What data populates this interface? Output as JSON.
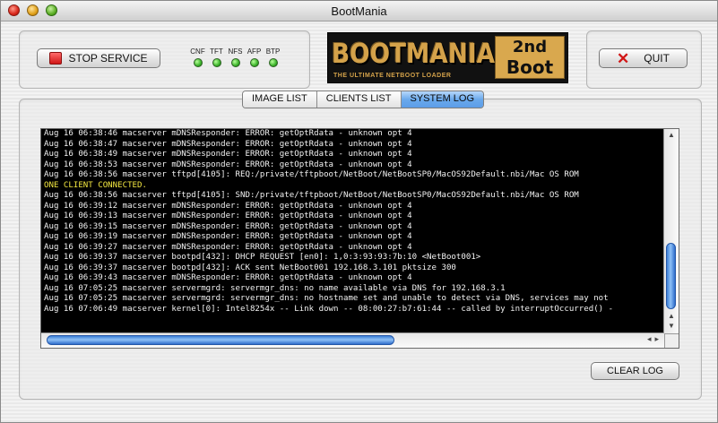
{
  "window": {
    "title": "BootMania"
  },
  "controls": {
    "stop_label": "STOP SERVICE",
    "quit_label": "QUIT"
  },
  "status_leds": [
    {
      "label": "CNF",
      "state": "on"
    },
    {
      "label": "TFT",
      "state": "on"
    },
    {
      "label": "NFS",
      "state": "on"
    },
    {
      "label": "AFP",
      "state": "on"
    },
    {
      "label": "BTP",
      "state": "on"
    }
  ],
  "logo": {
    "main": "BOOTMANIA",
    "subtitle": "THE ULTIMATE NETBOOT LOADER",
    "badge_line1": "2nd",
    "badge_line2": "Boot"
  },
  "tabs": [
    {
      "label": "IMAGE LIST",
      "active": false
    },
    {
      "label": "CLIENTS LIST",
      "active": false
    },
    {
      "label": "SYSTEM LOG",
      "active": true
    }
  ],
  "log": {
    "lines": [
      {
        "text": "Aug 16 06:38:46 macserver mDNSResponder: ERROR: getOptRdata - unknown opt 4",
        "color": "white"
      },
      {
        "text": "Aug 16 06:38:47 macserver mDNSResponder: ERROR: getOptRdata - unknown opt 4",
        "color": "white"
      },
      {
        "text": "Aug 16 06:38:49 macserver mDNSResponder: ERROR: getOptRdata - unknown opt 4",
        "color": "white"
      },
      {
        "text": "Aug 16 06:38:53 macserver mDNSResponder: ERROR: getOptRdata - unknown opt 4",
        "color": "white"
      },
      {
        "text": "Aug 16 06:38:56 macserver tftpd[4105]: REQ:/private/tftpboot/NetBoot/NetBootSP0/MacOS92Default.nbi/Mac OS ROM",
        "color": "white"
      },
      {
        "text": "ONE CLIENT CONNECTED.",
        "color": "yellow"
      },
      {
        "text": "Aug 16 06:38:56 macserver tftpd[4105]: SND:/private/tftpboot/NetBoot/NetBootSP0/MacOS92Default.nbi/Mac OS ROM",
        "color": "white"
      },
      {
        "text": "Aug 16 06:39:12 macserver mDNSResponder: ERROR: getOptRdata - unknown opt 4",
        "color": "white"
      },
      {
        "text": "Aug 16 06:39:13 macserver mDNSResponder: ERROR: getOptRdata - unknown opt 4",
        "color": "white"
      },
      {
        "text": "Aug 16 06:39:15 macserver mDNSResponder: ERROR: getOptRdata - unknown opt 4",
        "color": "white"
      },
      {
        "text": "Aug 16 06:39:19 macserver mDNSResponder: ERROR: getOptRdata - unknown opt 4",
        "color": "white"
      },
      {
        "text": "Aug 16 06:39:27 macserver mDNSResponder: ERROR: getOptRdata - unknown opt 4",
        "color": "white"
      },
      {
        "text": "Aug 16 06:39:37 macserver bootpd[432]: DHCP REQUEST [en0]: 1,0:3:93:93:7b:10 <NetBoot001>",
        "color": "white"
      },
      {
        "text": "Aug 16 06:39:37 macserver bootpd[432]: ACK sent NetBoot001 192.168.3.101 pktsize 300",
        "color": "white"
      },
      {
        "text": "Aug 16 06:39:43 macserver mDNSResponder: ERROR: getOptRdata - unknown opt 4",
        "color": "white"
      },
      {
        "text": "Aug 16 07:05:25 macserver servermgrd: servermgr_dns: no name available via DNS for 192.168.3.1",
        "color": "white"
      },
      {
        "text": "Aug 16 07:05:25 macserver servermgrd: servermgr_dns: no hostname set and unable to detect via DNS, services may not",
        "color": "white"
      },
      {
        "text": "Aug 16 07:06:49 macserver kernel[0]: Intel8254x -- Link down -- 08:00:27:b7:61:44 -- called by interruptOccurred() -",
        "color": "white"
      }
    ]
  },
  "clear_log_label": "CLEAR LOG",
  "colors": {
    "log_bg": "#000000",
    "log_text": "#f2f2f2",
    "log_highlight": "#f2e640",
    "accent_blue": "#5c9de8"
  }
}
